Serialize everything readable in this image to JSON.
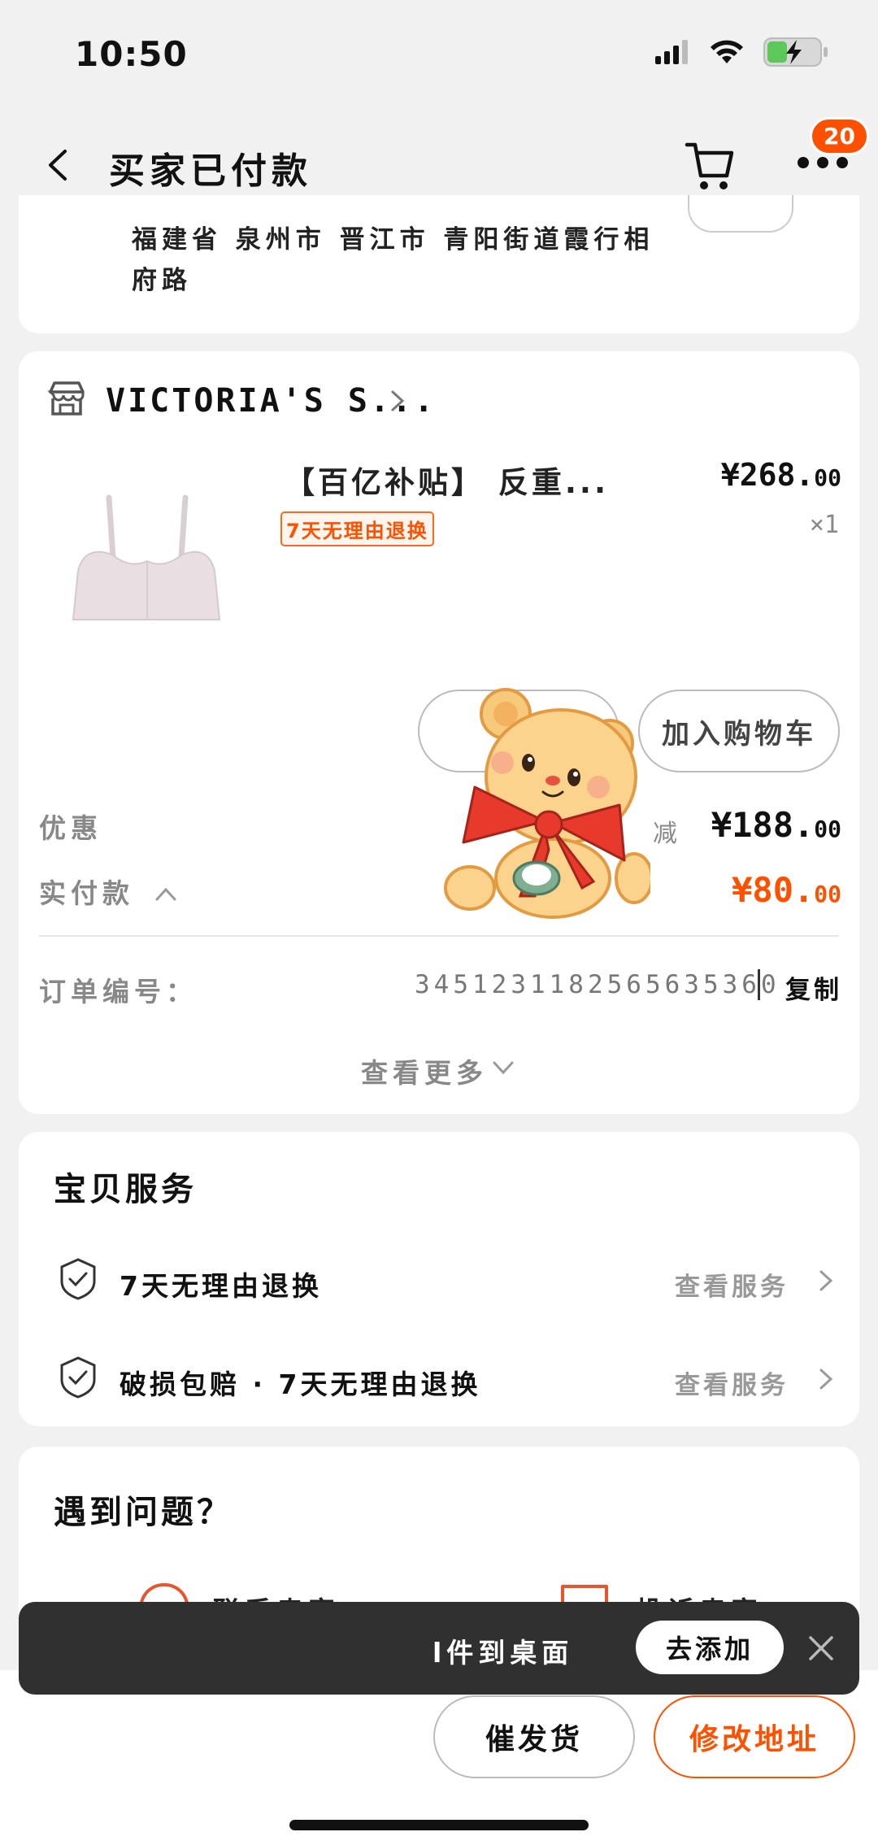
{
  "status_bar": {
    "time": "10:50"
  },
  "nav": {
    "title": "买家已付款",
    "cart_badge": "20"
  },
  "address": {
    "text": "福建省 泉州市 晋江市 青阳街道霞行相府路"
  },
  "order": {
    "shop_name": "VICTORIA'S S...",
    "product": {
      "title": "【百亿补贴】 反重...",
      "tag": "7天无理由退换",
      "price_main": "¥268.",
      "price_cents": "00",
      "quantity": "×1"
    },
    "add_to_cart_label": "加入购物车",
    "discount_label": "优惠",
    "discount_reduce": "减",
    "discount_main": "¥188.",
    "discount_cents": "00",
    "paid_label": "实付款",
    "paid_main": "¥80.",
    "paid_cents": "00",
    "order_no_label": "订单编号：",
    "order_no": "3451231182565635360",
    "copy_label": "复制",
    "see_more_label": "查看更多"
  },
  "services": {
    "title": "宝贝服务",
    "items": [
      {
        "name": "7天无理由退换",
        "link": "查看服务"
      },
      {
        "name": "破损包赔 · 7天无理由退换",
        "link": "查看服务"
      }
    ]
  },
  "problems": {
    "title": "遇到问题？",
    "contact_seller": "联系卖家",
    "complain_seller": "投诉卖家"
  },
  "toast": {
    "text": "l件到桌面",
    "action": "去添加"
  },
  "bottom": {
    "urge_label": "催发货",
    "change_address_label": "修改地址"
  },
  "colors": {
    "accent": "#ff5000",
    "toast_bg": "#303030"
  }
}
